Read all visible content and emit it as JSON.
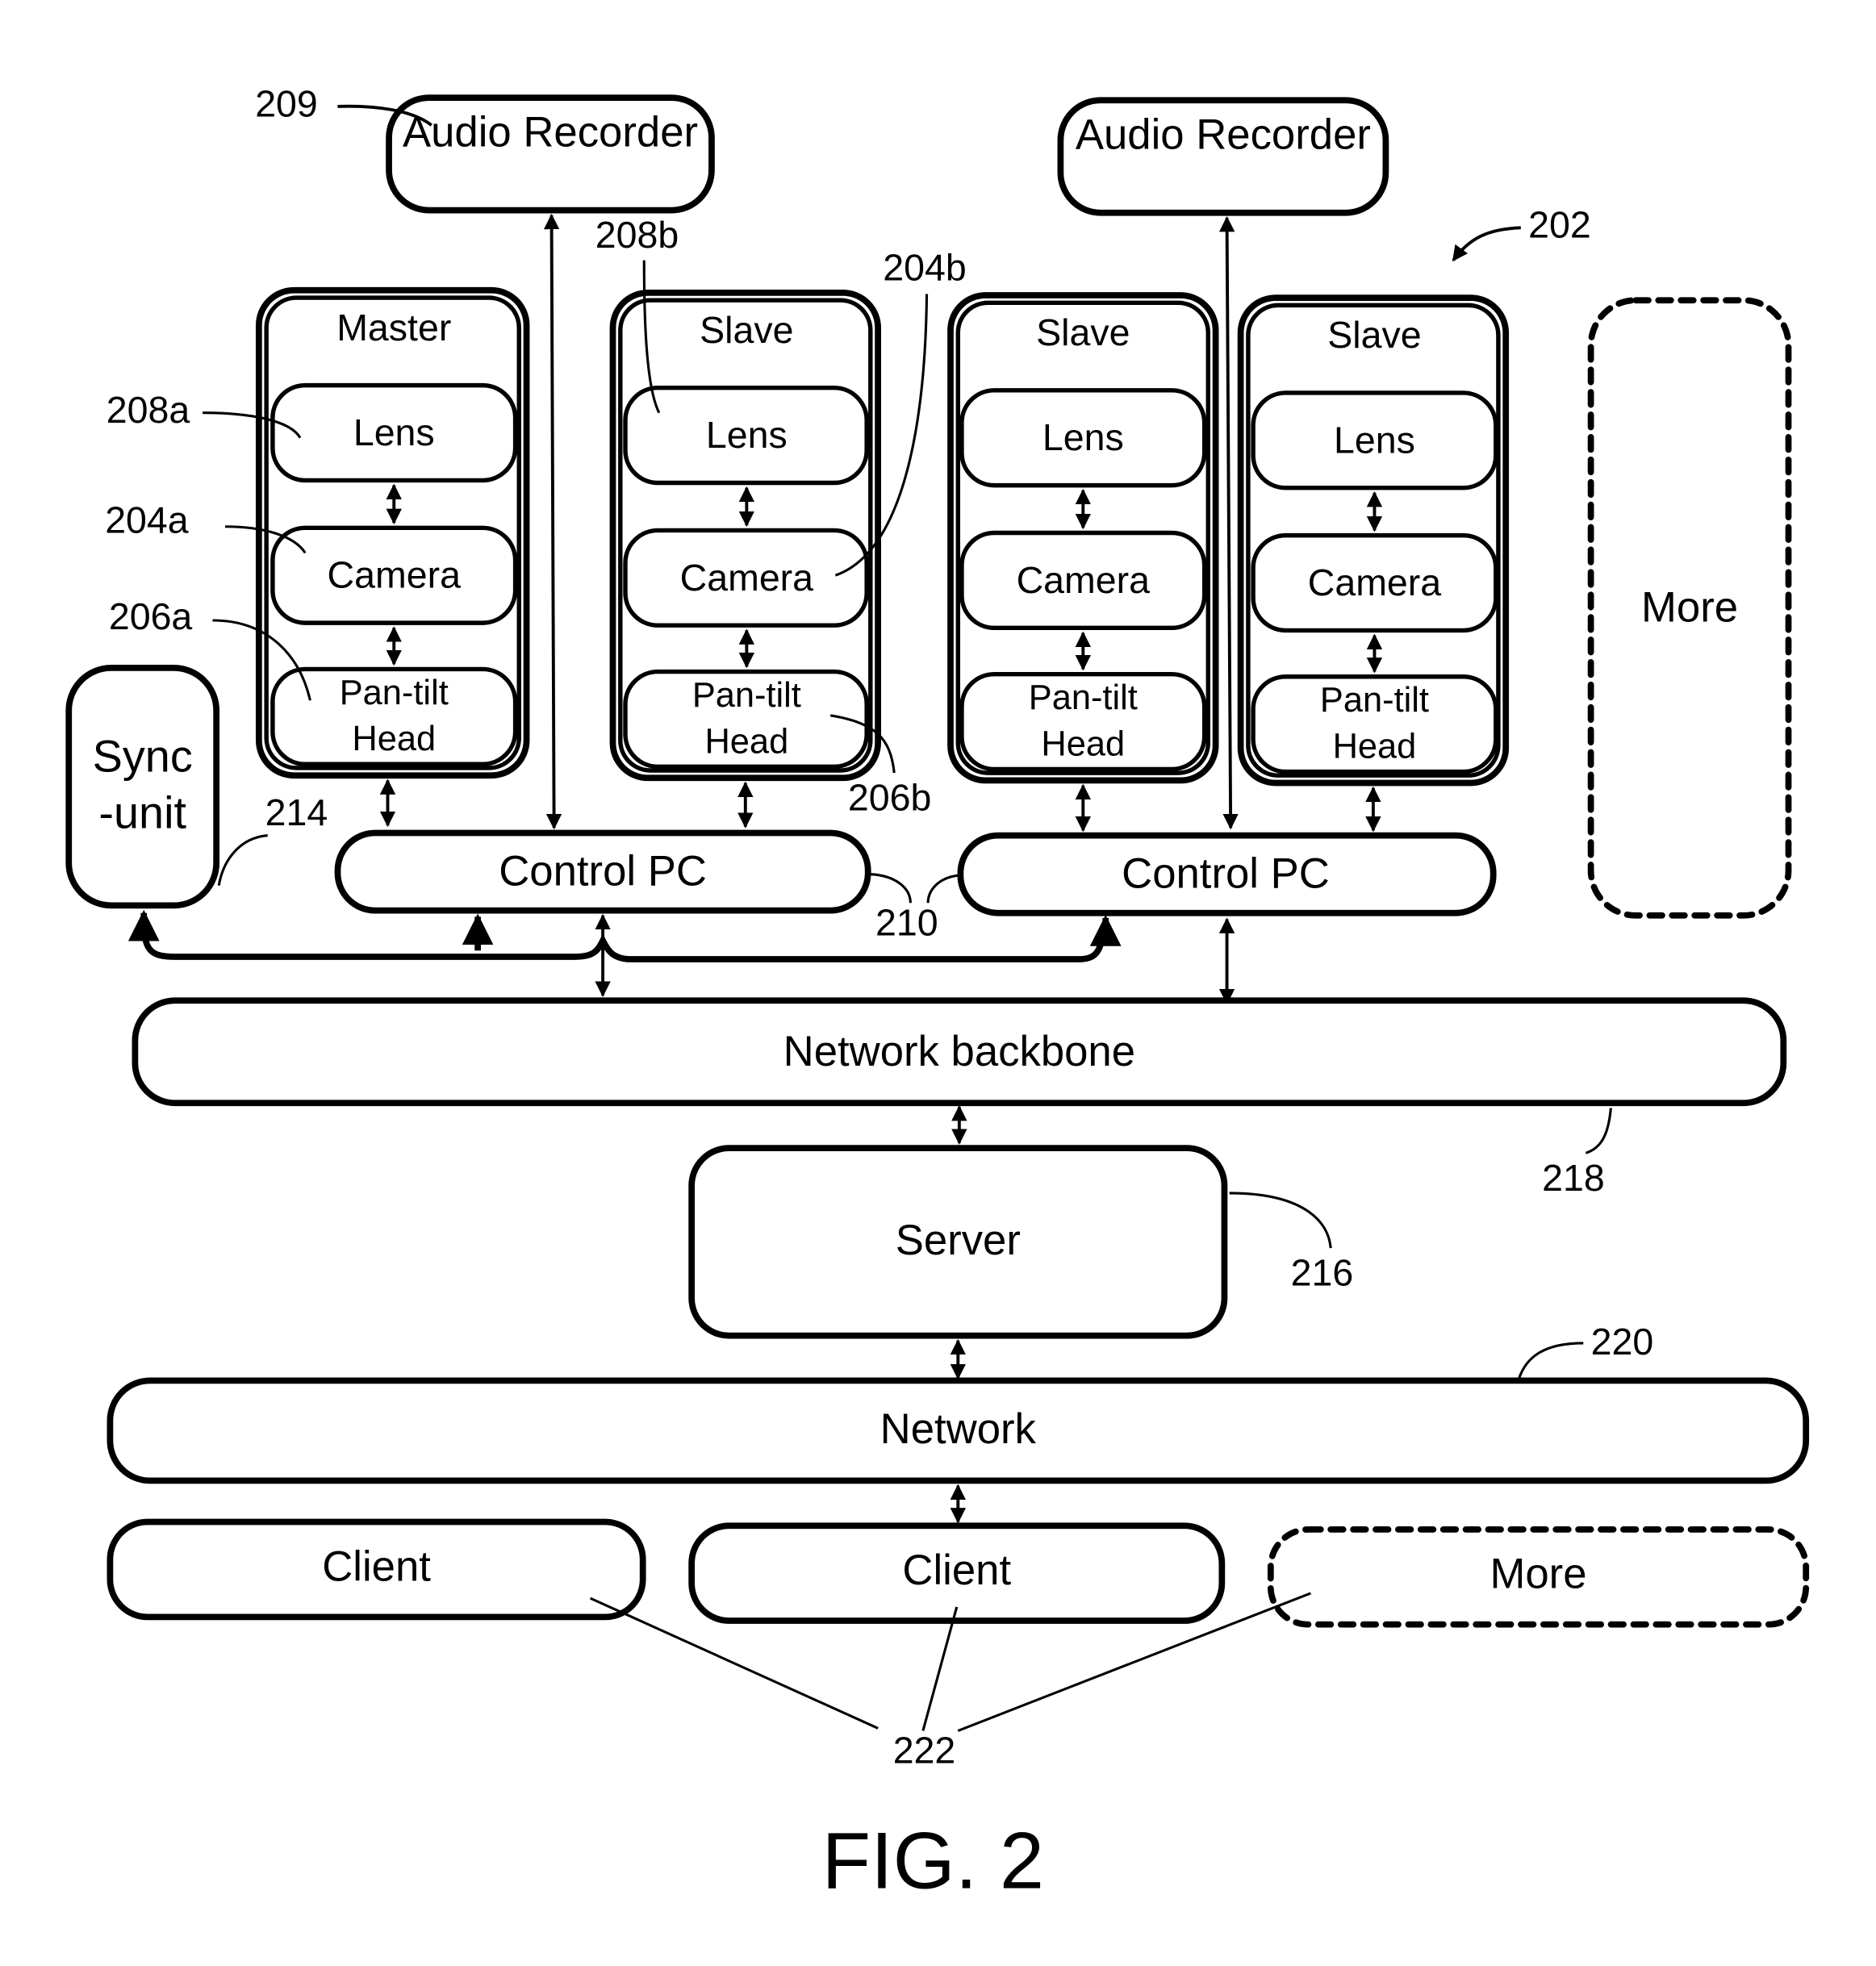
{
  "figure": {
    "caption": "FIG. 2",
    "system_ref": "202"
  },
  "audio_recorders": [
    {
      "label": "Audio Recorder",
      "ref": "209"
    },
    {
      "label": "Audio Recorder"
    }
  ],
  "camera_units": [
    {
      "role": "Master",
      "lens": "Lens",
      "camera": "Camera",
      "head_line1": "Pan-tilt",
      "head_line2": "Head"
    },
    {
      "role": "Slave",
      "lens": "Lens",
      "camera": "Camera",
      "head_line1": "Pan-tilt",
      "head_line2": "Head"
    },
    {
      "role": "Slave",
      "lens": "Lens",
      "camera": "Camera",
      "head_line1": "Pan-tilt",
      "head_line2": "Head"
    },
    {
      "role": "Slave",
      "lens": "Lens",
      "camera": "Camera",
      "head_line1": "Pan-tilt",
      "head_line2": "Head"
    }
  ],
  "more_cameras": {
    "label": "More"
  },
  "sync_unit": {
    "line1": "Sync",
    "line2": "-unit",
    "ref": "214"
  },
  "control_pcs": [
    {
      "label": "Control PC"
    },
    {
      "label": "Control PC"
    }
  ],
  "network_backbone": {
    "label": "Network backbone",
    "ref": "218"
  },
  "server": {
    "label": "Server",
    "ref": "216"
  },
  "network": {
    "label": "Network",
    "ref": "220"
  },
  "clients": [
    {
      "label": "Client"
    },
    {
      "label": "Client"
    },
    {
      "label": "More"
    }
  ],
  "refs": {
    "lens_a": "208a",
    "lens_b": "208b",
    "camera_a": "204a",
    "camera_b": "204b",
    "head_a": "206a",
    "head_b": "206b",
    "control_pc": "210",
    "clients": "222"
  }
}
